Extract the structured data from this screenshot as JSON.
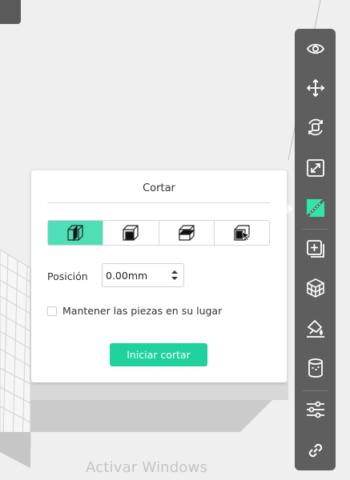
{
  "cut_panel": {
    "title": "Cortar",
    "modes": [
      {
        "name": "cut-plane-vertical",
        "active": true
      },
      {
        "name": "cut-plane-horizontal",
        "active": false
      },
      {
        "name": "cut-plane-middle",
        "active": false
      },
      {
        "name": "cut-by-click",
        "active": false
      }
    ],
    "position_label": "Posición",
    "position_value": "0.00mm",
    "keep_parts_label": "Mantener las piezas en su lugar",
    "keep_parts_checked": false,
    "start_button_label": "Iniciar cortar"
  },
  "toolbar": {
    "icons": [
      "eye-icon",
      "move-icon",
      "rotate-icon",
      "scale-icon",
      "cut-icon",
      "add-part-icon",
      "support-icon",
      "paint-icon",
      "cylinder-icon",
      "settings-sliders-icon",
      "link-icon"
    ],
    "active_icon": "cut-icon",
    "accent_color": "#2ee6a8"
  },
  "watermark": "Activar Windows",
  "colors": {
    "accent": "#1fd19c",
    "active_mode": "#4fdfb7",
    "toolbar_bg": "#5e5e5e"
  }
}
